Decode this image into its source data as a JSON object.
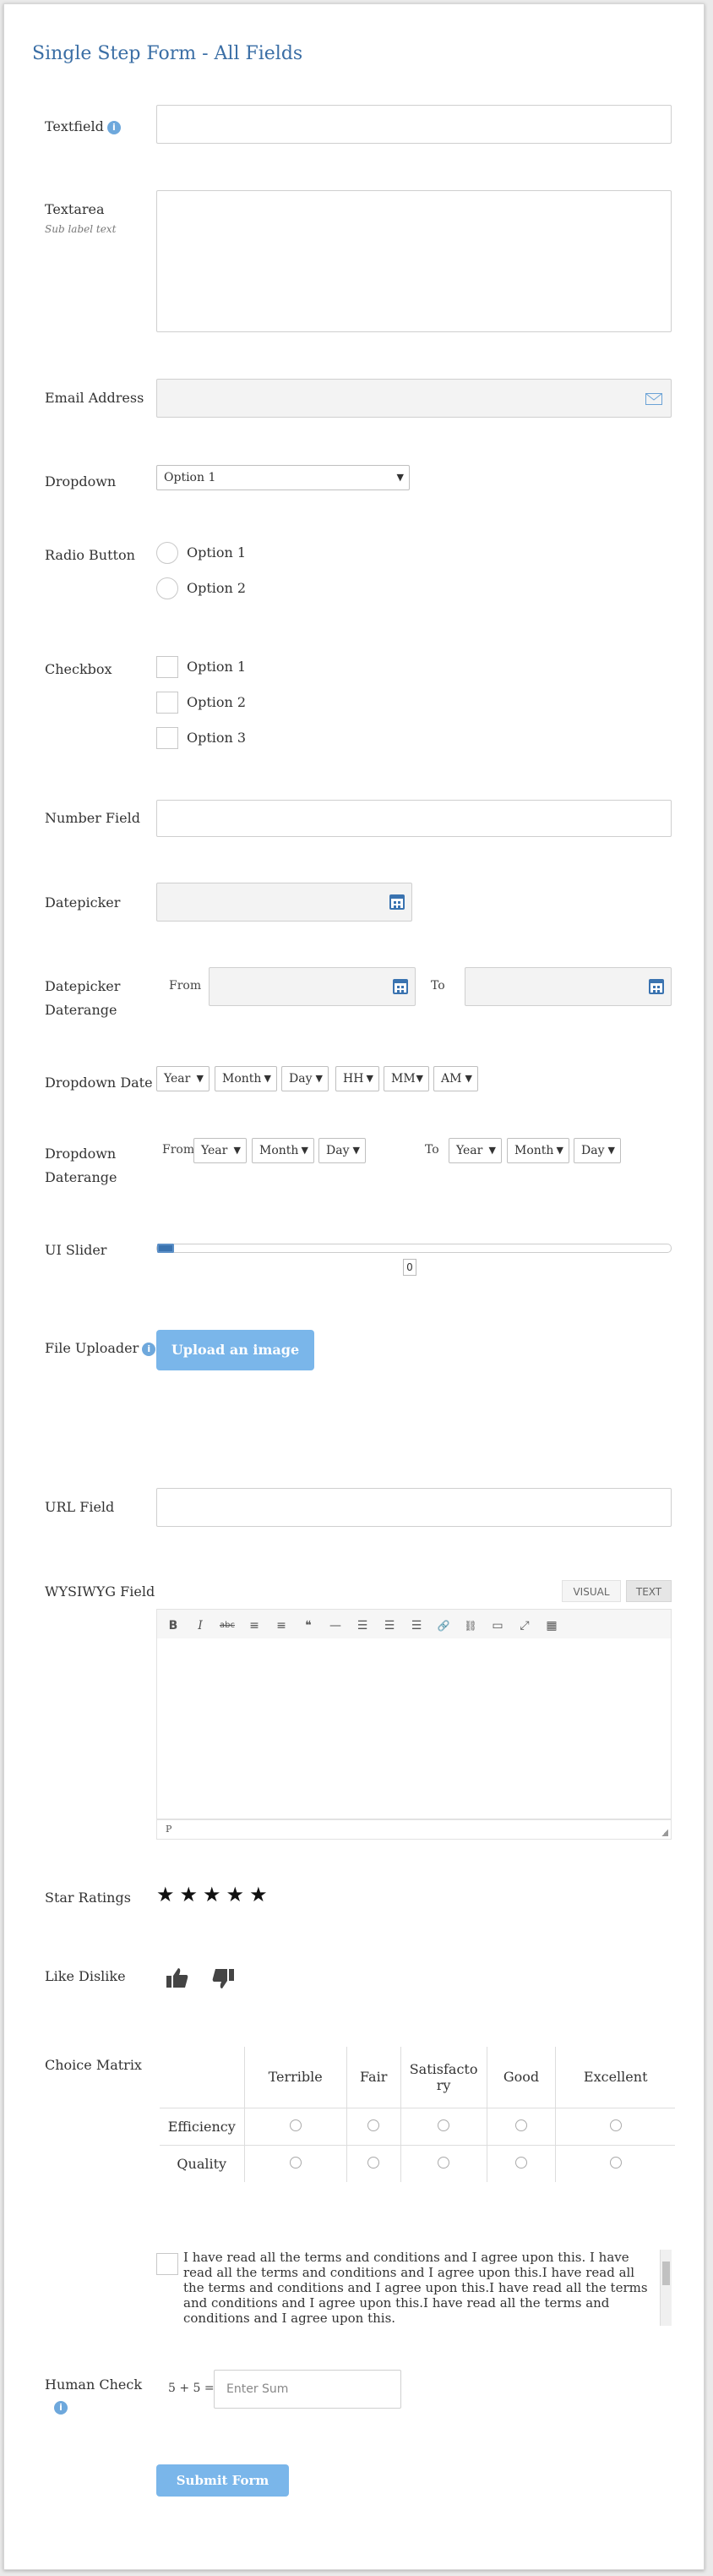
{
  "form_title": "Single Step Form - All Fields",
  "fields": {
    "textfield_label": "Textfield",
    "textarea_label": "Textarea",
    "textarea_sublabel": "Sub label text",
    "email_label": "Email Address",
    "dropdown_label": "Dropdown",
    "dropdown_value": "Option 1",
    "radio_label": "Radio Button",
    "radio_options": [
      "Option 1",
      "Option 2"
    ],
    "checkbox_label": "Checkbox",
    "checkbox_options": [
      "Option 1",
      "Option 2",
      "Option 3"
    ],
    "number_label": "Number Field",
    "datepicker_label": "Datepicker",
    "daterange_label": "Datepicker Daterange",
    "from_text": "From",
    "to_text": "To",
    "dropdown_date_label": "Dropdown Date",
    "dropdown_date_parts": [
      "Year",
      "Month",
      "Day",
      "HH",
      "MM",
      "AM"
    ],
    "dropdown_daterange_label": "Dropdown Daterange",
    "date_parts": [
      "Year",
      "Month",
      "Day"
    ],
    "slider_label": "UI Slider",
    "slider_value": "0",
    "slider_fraction": 0,
    "file_label": "File Uploader",
    "upload_button": "Upload an image",
    "url_label": "URL Field",
    "wysiwyg_label": "WYSIWYG Field",
    "wysiwyg_tab_visual": "VISUAL",
    "wysiwyg_tab_text": "TEXT",
    "wysiwyg_path": "P",
    "star_label": "Star Ratings",
    "star_count": 5,
    "like_label": "Like Dislike",
    "matrix_label": "Choice Matrix",
    "matrix_columns": [
      "Terrible",
      "Fair",
      "Satisfacto ry",
      "Good",
      "Excellent"
    ],
    "matrix_rows": [
      "Efficiency",
      "Quality"
    ],
    "terms_text": "I have read all the terms and conditions and I agree upon this. I have read all the terms and conditions and I agree upon this.I have read all the terms and conditions and I agree upon this.I have read all the terms and conditions and I agree upon this.I have read all the terms and conditions and I agree upon this.",
    "human_check_label": "Human Check",
    "captcha_question": "5 + 5 =",
    "captcha_placeholder": "Enter Sum",
    "submit_label": "Submit Form"
  },
  "colors": {
    "title": "#3a6ea5",
    "button": "#7ab6ea",
    "icon_blue": "#3a73b0"
  },
  "icons": {
    "info": "info-icon",
    "info_glyph": "i",
    "email": "envelope-icon",
    "calendar": "calendar-icon",
    "star": "★",
    "thumbs_up": "👍",
    "thumbs_down": "👎",
    "dropdown_arrow": "▼"
  },
  "toolbar": {
    "bold": "B",
    "italic": "I",
    "strike": "abc",
    "ul": "≡",
    "ol": "≡",
    "quote": "❝",
    "hr": "—",
    "align_left": "☰",
    "align_center": "☰",
    "align_right": "☰",
    "link": "🔗",
    "unlink": "⛓",
    "more": "▭",
    "fullscreen": "⤢",
    "kitchen": "▦"
  }
}
